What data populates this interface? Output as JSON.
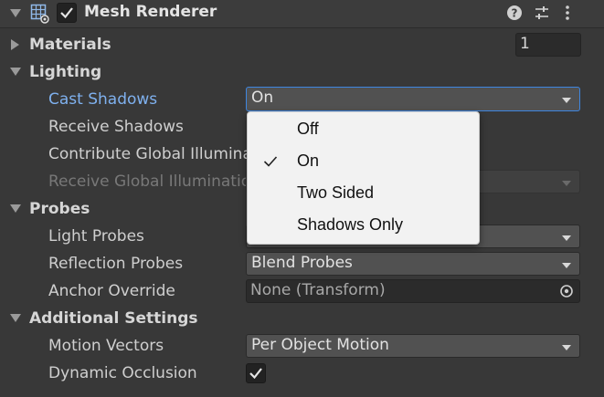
{
  "component": {
    "title": "Mesh Renderer",
    "enabled": true,
    "icons": [
      "mesh-renderer-icon",
      "help-icon",
      "preset-sliders-icon",
      "kebab-menu-icon"
    ]
  },
  "materials": {
    "label": "Materials",
    "count": "1"
  },
  "lighting": {
    "label": "Lighting",
    "cast_shadows": {
      "label": "Cast Shadows",
      "value": "On"
    },
    "receive_shadows": {
      "label": "Receive Shadows"
    },
    "contribute_gi": {
      "label": "Contribute Global Illumina"
    },
    "receive_gi": {
      "label": "Receive Global Illuminatio"
    }
  },
  "cast_shadows_menu": {
    "options": [
      "Off",
      "On",
      "Two Sided",
      "Shadows Only"
    ],
    "selected": "On"
  },
  "probes": {
    "label": "Probes",
    "light_probes": {
      "label": "Light Probes"
    },
    "reflection_probes": {
      "label": "Reflection Probes",
      "value": "Blend Probes"
    },
    "anchor_override": {
      "label": "Anchor Override",
      "value": "None (Transform)"
    }
  },
  "additional": {
    "label": "Additional Settings",
    "motion_vectors": {
      "label": "Motion Vectors",
      "value": "Per Object Motion"
    },
    "dynamic_occlusion": {
      "label": "Dynamic Occlusion",
      "checked": true
    }
  },
  "colors": {
    "accent": "#3e86e0",
    "active_label": "#7fb1ef",
    "background": "#383838"
  }
}
